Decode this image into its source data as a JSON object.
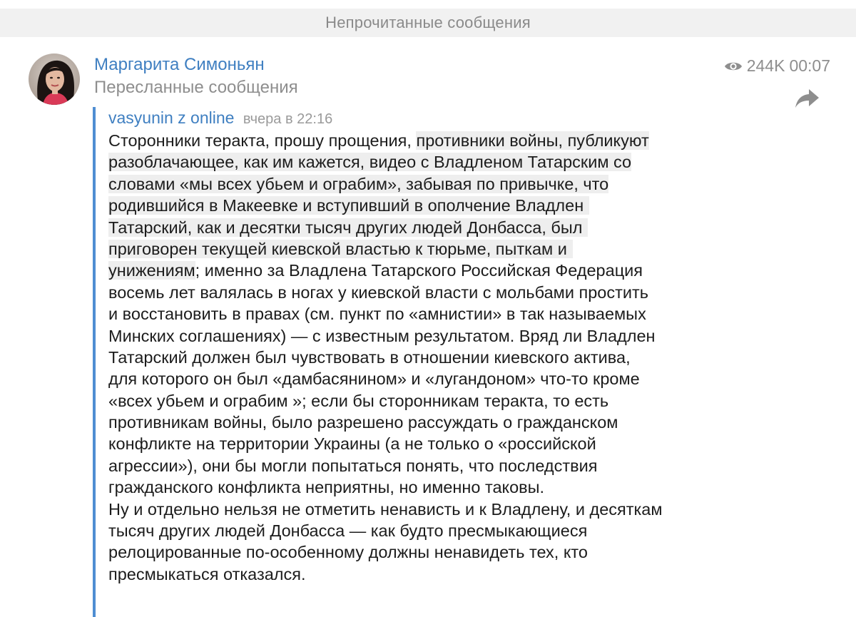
{
  "unread_banner": "Непрочитанные сообщения",
  "post": {
    "sender": "Маргарита Симоньян",
    "forwarded_label": "Пересланные сообщения",
    "views": "244K",
    "time": "00:07",
    "forwarded_from": {
      "author": "vasyunin z online",
      "timestamp": "вчера в 22:16"
    },
    "text": {
      "l1a": "Сторонники теракта, прошу прощения, ",
      "l1b": "противники войны, публикуют",
      "l2": "разоблачающее, как им кажется, видео с Владленом Татарским со",
      "l3": "словами «мы всех убьем и ограбим», забывая по привычке, что",
      "l4": "родившийся в Макеевке и вступивший в ополчение Владлен",
      "l5": "Татарский, как и десятки тысяч других людей Донбасса, был",
      "l6": "приговорен текущей киевской властью к тюрьме, пыткам и",
      "l7a": "унижениям",
      "l7b": "; именно за Владлена Татарского Российская Федерация",
      "l8": "восемь лет валялась в ногах у киевской власти с мольбами простить",
      "l9": "и восстановить в правах (см. пункт по «амнистии» в так называемых",
      "l10": "Минских соглашениях) — с известным результатом. Вряд ли Владлен",
      "l11": "Татарский должен был чувствовать в отношении киевского актива,",
      "l12": "для которого он был «дамбасянином» и «лугандоном» что-то кроме",
      "l13": "«всех убьем и ограбим »; если бы сторонникам теракта, то есть",
      "l14": "противникам войны, было разрешено рассуждать о гражданском",
      "l15": "конфликте на территории Украины (а не только о «российской",
      "l16": "агрессии»), они бы могли попытаться понять, что последствия",
      "l17": "гражданского конфликта неприятны, но именно таковы.",
      "l18": "Ну и отдельно нельзя не отметить ненависть и к Владлену, и десяткам",
      "l19": "тысяч других людей Донбасса — как будто пресмыкающиеся",
      "l20": "релоцированные по-особенному должны ненавидеть тех, кто",
      "l21": "пресмыкаться отказался."
    }
  },
  "icons": {
    "views": "eye-icon",
    "share": "forward-arrow-icon",
    "avatar": "user-photo"
  },
  "colors": {
    "accent": "#3f7fc1",
    "quote_bar": "#4f8ed2",
    "muted_text": "#8e8e8e",
    "highlight": "#eeeeee"
  }
}
